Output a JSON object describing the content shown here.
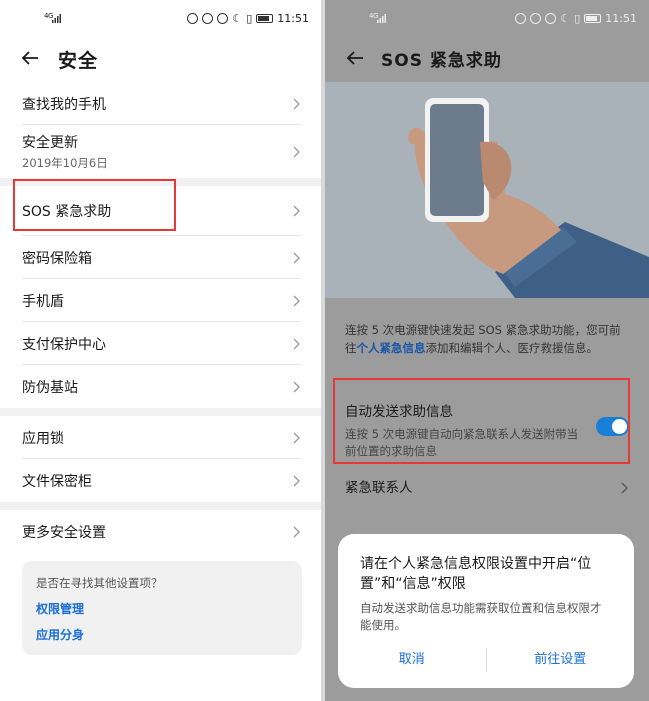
{
  "left": {
    "status": {
      "network": "4G",
      "time": "11:51"
    },
    "title": "安全",
    "items": [
      {
        "label": "查找我的手机"
      },
      {
        "label": "安全更新",
        "sub": "2019年10月6日"
      },
      {
        "label": "SOS 紧急求助"
      },
      {
        "label": "密码保险箱"
      },
      {
        "label": "手机盾"
      },
      {
        "label": "支付保护中心"
      },
      {
        "label": "防伪基站"
      },
      {
        "label": "应用锁"
      },
      {
        "label": "文件保密柜"
      },
      {
        "label": "更多安全设置"
      }
    ],
    "search_card": {
      "question": "是否在寻找其他设置项？",
      "links": [
        "权限管理",
        "应用分身"
      ]
    }
  },
  "right": {
    "status": {
      "network": "4G",
      "time": "11:51"
    },
    "title": "SOS 紧急求助",
    "desc_pre": "连按 5 次电源键快速发起 SOS 紧急求助功能，您可前往",
    "desc_link": "个人紧急信息",
    "desc_post": "添加和编辑个人、医疗救援信息。",
    "auto_send": {
      "label": "自动发送求助信息",
      "sub": "连按 5 次电源键自动向紧急联系人发送附带当前位置的求助信息",
      "enabled": true
    },
    "contacts_label": "紧急联系人",
    "dialog": {
      "title": "请在个人紧急信息权限设置中开启“位置”和“信息”权限",
      "body": "自动发送求助信息功能需获取位置和信息权限才能使用。",
      "cancel": "取消",
      "confirm": "前往设置"
    }
  },
  "colors": {
    "accent": "#1a6fd6",
    "highlight": "#e53935"
  },
  "icons": [
    "back-arrow-icon",
    "chevron-right-icon",
    "signal-icon",
    "battery-icon",
    "alarm-icon",
    "moon-icon",
    "vibrate-icon",
    "nfc-icon",
    "eye-icon"
  ]
}
